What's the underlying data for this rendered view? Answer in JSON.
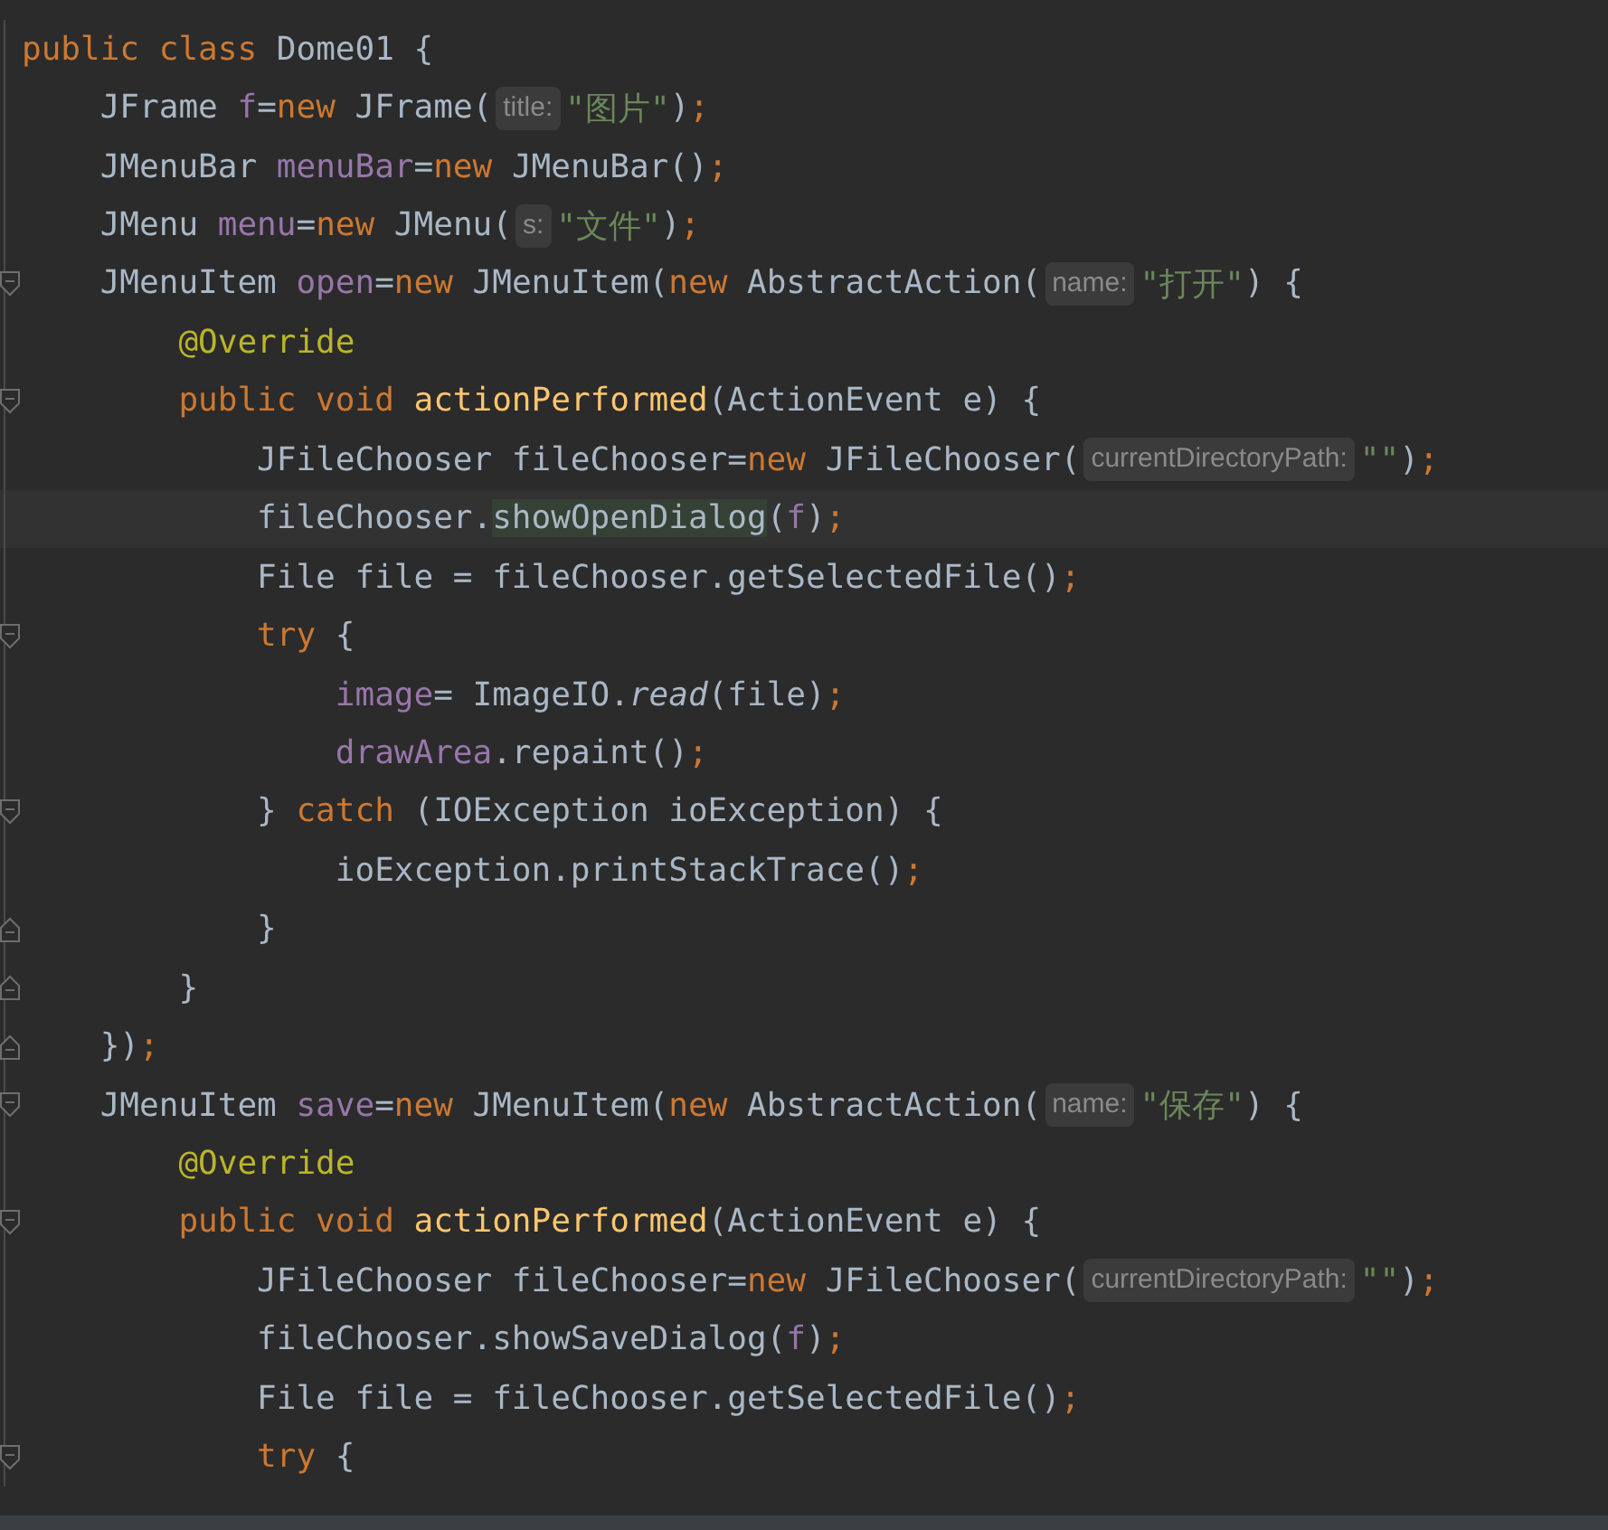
{
  "editor": {
    "lines": [
      {
        "tokens": [
          {
            "kind": "keyword",
            "text": "public class "
          },
          {
            "kind": "plain",
            "text": "Dome01 {"
          }
        ]
      },
      {
        "tokens": [
          {
            "kind": "plain",
            "text": "    JFrame "
          },
          {
            "kind": "field",
            "text": "f"
          },
          {
            "kind": "plain",
            "text": "="
          },
          {
            "kind": "keyword",
            "text": "new"
          },
          {
            "kind": "plain",
            "text": " JFrame("
          },
          {
            "kind": "hint",
            "text": "title:"
          },
          {
            "kind": "string",
            "text": "\"图片\""
          },
          {
            "kind": "plain",
            "text": ")"
          },
          {
            "kind": "keyword",
            "text": ";"
          }
        ]
      },
      {
        "tokens": [
          {
            "kind": "plain",
            "text": "    JMenuBar "
          },
          {
            "kind": "field",
            "text": "menuBar"
          },
          {
            "kind": "plain",
            "text": "="
          },
          {
            "kind": "keyword",
            "text": "new"
          },
          {
            "kind": "plain",
            "text": " JMenuBar()"
          },
          {
            "kind": "keyword",
            "text": ";"
          }
        ]
      },
      {
        "tokens": [
          {
            "kind": "plain",
            "text": "    JMenu "
          },
          {
            "kind": "field",
            "text": "menu"
          },
          {
            "kind": "plain",
            "text": "="
          },
          {
            "kind": "keyword",
            "text": "new"
          },
          {
            "kind": "plain",
            "text": " JMenu("
          },
          {
            "kind": "hint",
            "text": "s:"
          },
          {
            "kind": "string",
            "text": "\"文件\""
          },
          {
            "kind": "plain",
            "text": ")"
          },
          {
            "kind": "keyword",
            "text": ";"
          }
        ]
      },
      {
        "fold_start": true,
        "tokens": [
          {
            "kind": "plain",
            "text": "    JMenuItem "
          },
          {
            "kind": "field",
            "text": "open"
          },
          {
            "kind": "plain",
            "text": "="
          },
          {
            "kind": "keyword",
            "text": "new"
          },
          {
            "kind": "plain",
            "text": " JMenuItem("
          },
          {
            "kind": "keyword",
            "text": "new"
          },
          {
            "kind": "plain",
            "text": " AbstractAction("
          },
          {
            "kind": "hint",
            "text": "name:"
          },
          {
            "kind": "string",
            "text": "\"打开\""
          },
          {
            "kind": "plain",
            "text": ") {"
          }
        ]
      },
      {
        "tokens": [
          {
            "kind": "annotation",
            "text": "        @Override"
          }
        ]
      },
      {
        "fold_start": true,
        "tokens": [
          {
            "kind": "keyword",
            "text": "        public void "
          },
          {
            "kind": "method",
            "text": "actionPerformed"
          },
          {
            "kind": "plain",
            "text": "(ActionEvent e) {"
          }
        ]
      },
      {
        "tokens": [
          {
            "kind": "plain",
            "text": "            JFileChooser fileChooser="
          },
          {
            "kind": "keyword",
            "text": "new"
          },
          {
            "kind": "plain",
            "text": " JFileChooser("
          },
          {
            "kind": "hint",
            "text": "currentDirectoryPath:"
          },
          {
            "kind": "string",
            "text": "\"\""
          },
          {
            "kind": "plain",
            "text": ")"
          },
          {
            "kind": "keyword",
            "text": ";"
          }
        ]
      },
      {
        "current": true,
        "tokens": [
          {
            "kind": "plain",
            "text": "            fileChooser."
          },
          {
            "kind": "highlight",
            "text": "showOpenDialog"
          },
          {
            "kind": "plain",
            "text": "("
          },
          {
            "kind": "field",
            "text": "f"
          },
          {
            "kind": "plain",
            "text": ")"
          },
          {
            "kind": "keyword",
            "text": ";"
          }
        ]
      },
      {
        "tokens": [
          {
            "kind": "plain",
            "text": "            File file = fileChooser.getSelectedFile()"
          },
          {
            "kind": "keyword",
            "text": ";"
          }
        ]
      },
      {
        "fold_start": true,
        "tokens": [
          {
            "kind": "keyword",
            "text": "            try"
          },
          {
            "kind": "plain",
            "text": " {"
          }
        ]
      },
      {
        "tokens": [
          {
            "kind": "field",
            "text": "                image"
          },
          {
            "kind": "plain",
            "text": "= ImageIO."
          },
          {
            "kind": "static",
            "text": "read"
          },
          {
            "kind": "plain",
            "text": "(file)"
          },
          {
            "kind": "keyword",
            "text": ";"
          }
        ]
      },
      {
        "tokens": [
          {
            "kind": "field",
            "text": "                drawArea"
          },
          {
            "kind": "plain",
            "text": ".repaint()"
          },
          {
            "kind": "keyword",
            "text": ";"
          }
        ]
      },
      {
        "fold_start": true,
        "tokens": [
          {
            "kind": "plain",
            "text": "            } "
          },
          {
            "kind": "keyword",
            "text": "catch"
          },
          {
            "kind": "plain",
            "text": " (IOException ioException) {"
          }
        ]
      },
      {
        "tokens": [
          {
            "kind": "plain",
            "text": "                ioException.printStackTrace()"
          },
          {
            "kind": "keyword",
            "text": ";"
          }
        ]
      },
      {
        "fold_end": true,
        "tokens": [
          {
            "kind": "plain",
            "text": "            }"
          }
        ]
      },
      {
        "fold_end": true,
        "tokens": [
          {
            "kind": "plain",
            "text": "        }"
          }
        ]
      },
      {
        "fold_end": true,
        "tokens": [
          {
            "kind": "plain",
            "text": "    })"
          },
          {
            "kind": "keyword",
            "text": ";"
          }
        ]
      },
      {
        "fold_start": true,
        "tokens": [
          {
            "kind": "plain",
            "text": "    JMenuItem "
          },
          {
            "kind": "field",
            "text": "save"
          },
          {
            "kind": "plain",
            "text": "="
          },
          {
            "kind": "keyword",
            "text": "new"
          },
          {
            "kind": "plain",
            "text": " JMenuItem("
          },
          {
            "kind": "keyword",
            "text": "new"
          },
          {
            "kind": "plain",
            "text": " AbstractAction("
          },
          {
            "kind": "hint",
            "text": "name:"
          },
          {
            "kind": "string",
            "text": "\"保存\""
          },
          {
            "kind": "plain",
            "text": ") {"
          }
        ]
      },
      {
        "tokens": [
          {
            "kind": "annotation",
            "text": "        @Override"
          }
        ]
      },
      {
        "fold_start": true,
        "tokens": [
          {
            "kind": "keyword",
            "text": "        public void "
          },
          {
            "kind": "method",
            "text": "actionPerformed"
          },
          {
            "kind": "plain",
            "text": "(ActionEvent e) {"
          }
        ]
      },
      {
        "tokens": [
          {
            "kind": "plain",
            "text": "            JFileChooser fileChooser="
          },
          {
            "kind": "keyword",
            "text": "new"
          },
          {
            "kind": "plain",
            "text": " JFileChooser("
          },
          {
            "kind": "hint",
            "text": "currentDirectoryPath:"
          },
          {
            "kind": "string",
            "text": "\"\""
          },
          {
            "kind": "plain",
            "text": ")"
          },
          {
            "kind": "keyword",
            "text": ";"
          }
        ]
      },
      {
        "tokens": [
          {
            "kind": "plain",
            "text": "            fileChooser.showSaveDialog("
          },
          {
            "kind": "field",
            "text": "f"
          },
          {
            "kind": "plain",
            "text": ")"
          },
          {
            "kind": "keyword",
            "text": ";"
          }
        ]
      },
      {
        "tokens": [
          {
            "kind": "plain",
            "text": "            File file = fileChooser.getSelectedFile()"
          },
          {
            "kind": "keyword",
            "text": ";"
          }
        ]
      },
      {
        "fold_start": true,
        "tokens": [
          {
            "kind": "keyword",
            "text": "            try"
          },
          {
            "kind": "plain",
            "text": " {"
          }
        ]
      }
    ]
  }
}
